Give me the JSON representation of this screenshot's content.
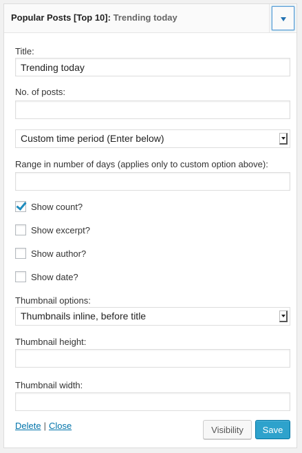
{
  "widget": {
    "title_main": "Popular Posts [Top 10]",
    "title_separator": ": ",
    "title_instance": "Trending today"
  },
  "fields": {
    "title_label": "Title:",
    "title_value": "Trending today",
    "num_posts_label": "No. of posts:",
    "num_posts_value": "",
    "time_period_value": "Custom time period (Enter below)",
    "range_label": "Range in number of days (applies only to custom option above):",
    "range_value": "",
    "thumbnail_options_label": "Thumbnail options:",
    "thumbnail_options_value": "Thumbnails inline, before title",
    "thumbnail_height_label": "Thumbnail height:",
    "thumbnail_height_value": "",
    "thumbnail_width_label": "Thumbnail width:",
    "thumbnail_width_value": ""
  },
  "checkboxes": [
    {
      "label": "Show count?",
      "checked": true
    },
    {
      "label": "Show excerpt?",
      "checked": false
    },
    {
      "label": "Show author?",
      "checked": false
    },
    {
      "label": "Show date?",
      "checked": false
    }
  ],
  "footer": {
    "delete_label": "Delete",
    "separator": "|",
    "close_label": "Close",
    "visibility_label": "Visibility",
    "save_label": "Save"
  },
  "colors": {
    "link": "#0073aa",
    "primary_button": "#2ea2cc",
    "checkmark": "#1e8cbe"
  }
}
